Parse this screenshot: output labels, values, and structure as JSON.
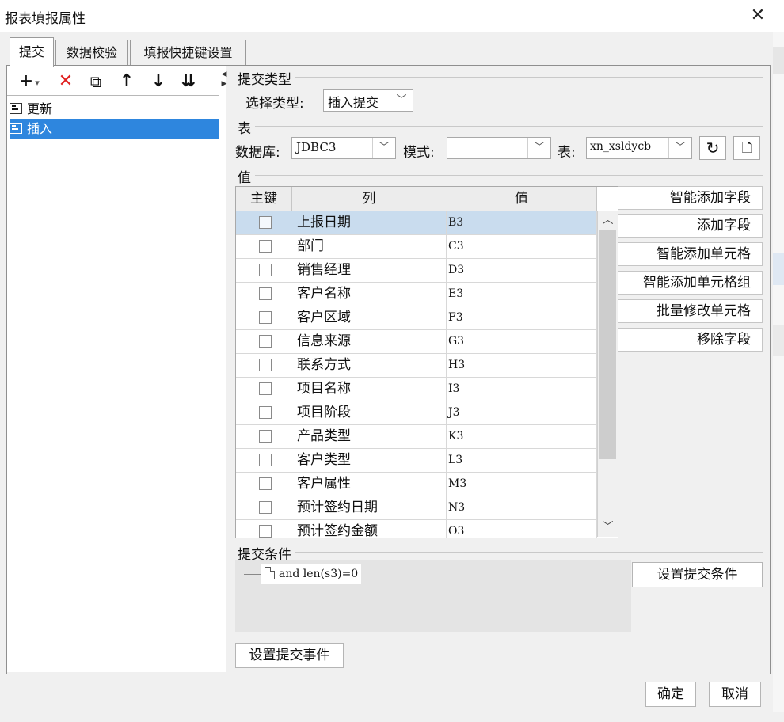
{
  "window": {
    "title": "报表填报属性",
    "close_glyph": "✕"
  },
  "tabs": [
    {
      "label": "提交"
    },
    {
      "label": "数据校验"
    },
    {
      "label": "填报快捷键设置"
    }
  ],
  "toolbar": {
    "add": "+",
    "add_dropdown": "▾",
    "delete": "✕",
    "copy": "⧉",
    "move_up": "↑",
    "move_down": "↓",
    "move_bottom": "⇊"
  },
  "tree": [
    {
      "label": "更新"
    },
    {
      "label": "插入"
    }
  ],
  "submit_type": {
    "section_title": "提交类型",
    "select_label": "选择类型:",
    "select_value": "插入提交"
  },
  "table_section": {
    "section_title": "表",
    "db_label": "数据库:",
    "db_value": "JDBC3",
    "schema_label": "模式:",
    "schema_value": "",
    "table_label": "表:",
    "table_value": "xn_xsldycb"
  },
  "values_section": {
    "section_title": "值",
    "headers": {
      "key": "主键",
      "column": "列",
      "value": "值"
    },
    "rows": [
      {
        "column": "上报日期",
        "value": "B3"
      },
      {
        "column": "部门",
        "value": "C3"
      },
      {
        "column": "销售经理",
        "value": "D3"
      },
      {
        "column": "客户名称",
        "value": "E3"
      },
      {
        "column": "客户区域",
        "value": "F3"
      },
      {
        "column": "信息来源",
        "value": "G3"
      },
      {
        "column": "联系方式",
        "value": "H3"
      },
      {
        "column": "项目名称",
        "value": "I3"
      },
      {
        "column": "项目阶段",
        "value": "J3"
      },
      {
        "column": "产品类型",
        "value": "K3"
      },
      {
        "column": "客户类型",
        "value": "L3"
      },
      {
        "column": "客户属性",
        "value": "M3"
      },
      {
        "column": "预计签约日期",
        "value": "N3"
      },
      {
        "column": "预计签约金额",
        "value": "O3"
      }
    ],
    "buttons": {
      "smart_add_field": "智能添加字段",
      "add_field": "添加字段",
      "smart_add_cell": "智能添加单元格",
      "smart_add_cell_group": "智能添加单元格组",
      "batch_modify_cell": "批量修改单元格",
      "remove_field": "移除字段"
    }
  },
  "condition_section": {
    "section_title": "提交条件",
    "node_text": "and len(s3)=0",
    "set_condition_button": "设置提交条件"
  },
  "set_event_button": "设置提交事件",
  "footer": {
    "ok": "确定",
    "cancel": "取消"
  }
}
